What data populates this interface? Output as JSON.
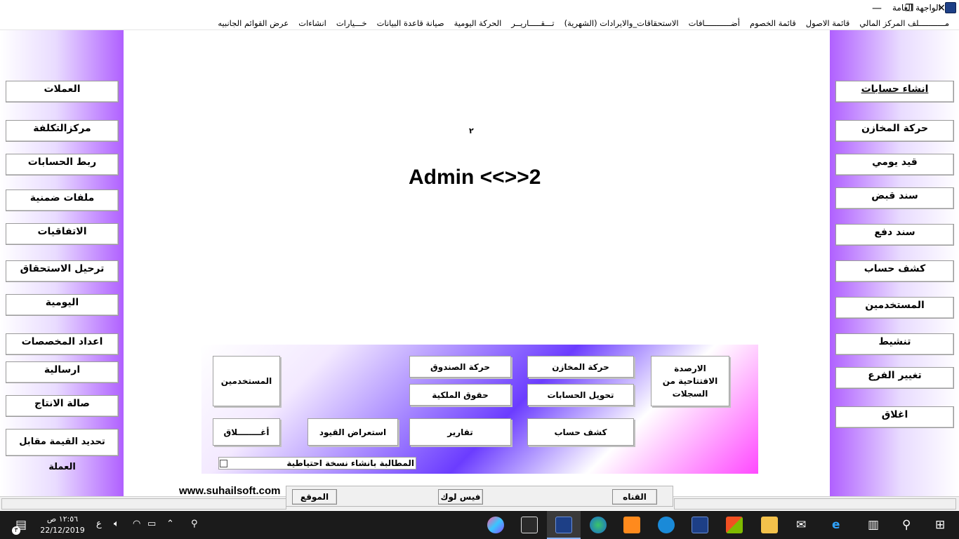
{
  "window": {
    "title": "الواجهة العامة",
    "controls": {
      "minimize": "—",
      "maximize": "❐",
      "close": "✕"
    }
  },
  "menu": [
    "مـــــــــــلف المركز المالي",
    "قائمة الاصول",
    "قائمة الخصوم",
    "أضـــــــــــافات",
    "الاستحقاقات_والايرادات (الشهرية)",
    "تـــقـــــاريــر",
    "الحركة اليومية",
    "صيانة قاعدة البيانات",
    "خـــيارات",
    "انشاءات",
    "عرض القوائم الجانبيه"
  ],
  "left_sidebar": [
    "العملات",
    "مركزالتكلفة",
    "ربط الحسابات",
    "ملفات ضمنية",
    "الاتفاقيات",
    "ترحيل الاستحقاق",
    "اليومية",
    "اعداد المخصصات",
    "ارسالية",
    "صالة الانتاج",
    "تحديد القيمة مقابل العملة"
  ],
  "right_sidebar": [
    "انشاء حسابات",
    "حركة المخازن",
    "قيد يومي",
    "سند قبض",
    "سند دفع",
    "كشف حساب",
    "المستخدمين",
    "تنشيط",
    "تغيير الفرع",
    "اغلاق"
  ],
  "center": {
    "small_number": "٢",
    "user_title": "Admin <<>>2"
  },
  "panel": {
    "opening_balances": "الارصدة الافتتاحية من السجلات",
    "warehouse_movement": "حركة المخازن",
    "cashbox_movement": "حركة الصندوق",
    "account_transfer": "تحويل  الحسابات",
    "equity": "حقوق الملكية",
    "users": "المستخدمين",
    "account_statement": "كشف حساب",
    "reports": "تقارير",
    "browse_entries": "استعراض القيود",
    "close": "أغــــــــلاق",
    "backup_prompt": "المطالبة بانشاء نسخة احتياطية"
  },
  "footer": {
    "website": "www.suhailsoft.com",
    "social_buttons": [
      "القناه",
      "فيس لوك",
      "الموقع"
    ]
  },
  "taskbar": {
    "time": "١٢:٥٦ ص",
    "date": "22/12/2019",
    "language": "ع",
    "notification_count": "٣"
  }
}
